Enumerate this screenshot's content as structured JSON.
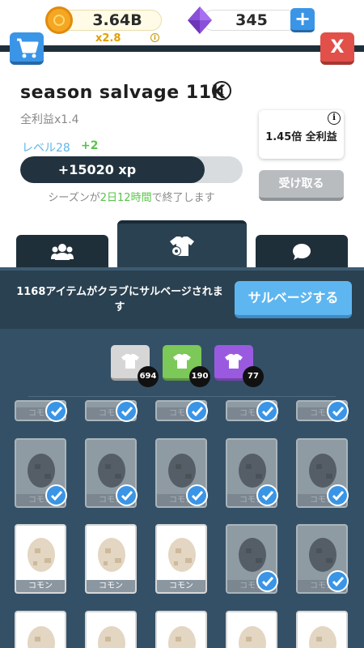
{
  "currency": {
    "coins": "3.64B",
    "multiplier": "x2.8",
    "gems": "345",
    "plus_label": "+"
  },
  "header": {
    "close_label": "X",
    "title": "season  salvage 11K",
    "profit_sub": "全利益x1.4",
    "level_label": "レベル28",
    "level_plus": "+2",
    "xp_text": "+15020 xp",
    "xp_progress": 0.83,
    "season_end_prefix": "シーズンが",
    "season_end_days": "2日",
    "season_end_hours": "12時間",
    "season_end_suffix": "で終了します",
    "profit_box": "1.45倍 全利益",
    "claim_label": "受け取る"
  },
  "tabs": [
    {
      "icon": "users-icon"
    },
    {
      "icon": "shirt-gear-icon"
    },
    {
      "icon": "chat-bubble-icon"
    }
  ],
  "salvage": {
    "banner_text": "1168アイテムがクラブにサルベージされます",
    "button_label": "サルベージする"
  },
  "filters": [
    {
      "color": "#d6d6d6",
      "count": "694"
    },
    {
      "color": "#7cc858",
      "count": "190"
    },
    {
      "color": "#9a5ae0",
      "count": "77"
    }
  ],
  "items": {
    "common_label": "コモン",
    "partial_row_labels": [
      "コモン",
      "コモン",
      "コモン",
      "コモン",
      "コモン"
    ],
    "row2_labels": [
      "コモン",
      "コモン",
      "コモン",
      "コモン",
      "コモン"
    ],
    "row3_labels": [
      "コモン",
      "コモン",
      "コモン",
      "コモン",
      "コモン"
    ]
  },
  "colors": {
    "dark": "#1f2f3a",
    "panel": "#345066",
    "accent_blue": "#3a95e6",
    "green": "#58c34a",
    "red": "#e2504a"
  }
}
